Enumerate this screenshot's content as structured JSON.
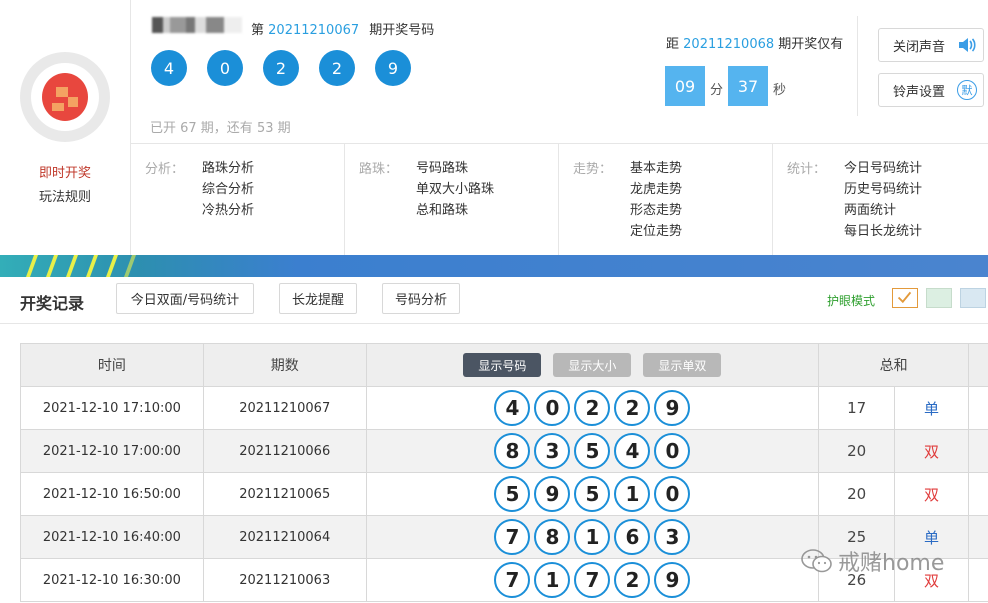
{
  "left": {
    "active_link": "即时开奖",
    "rules_link": "玩法规则"
  },
  "header": {
    "issue_prefix": "第",
    "issue": "20211210067",
    "issue_suffix": "期开奖号码",
    "balls": [
      "4",
      "0",
      "2",
      "2",
      "9"
    ],
    "opened_text": "已开 67 期，还有 53 期"
  },
  "countdown": {
    "prefix": "距",
    "next_issue": "20211210068",
    "suffix": "期开奖仅有",
    "minutes": "09",
    "minutes_unit": "分",
    "seconds": "37",
    "seconds_unit": "秒"
  },
  "side_buttons": {
    "mute": "关闭声音",
    "ringtone": "铃声设置",
    "ringtone_badge": "默"
  },
  "analysis": [
    {
      "title": "分析：",
      "items": [
        "路珠分析",
        "综合分析",
        "冷热分析"
      ]
    },
    {
      "title": "路珠：",
      "items": [
        "号码路珠",
        "单双大小路珠",
        "总和路珠"
      ]
    },
    {
      "title": "走势：",
      "items": [
        "基本走势",
        "龙虎走势",
        "形态走势",
        "定位走势"
      ]
    },
    {
      "title": "统计：",
      "items": [
        "今日号码统计",
        "历史号码统计",
        "两面统计",
        "每日长龙统计"
      ]
    }
  ],
  "toolbar": {
    "title": "开奖记录",
    "btn_today": "今日双面/号码统计",
    "btn_dragon": "长龙提醒",
    "btn_analysis": "号码分析",
    "eye_mode": "护眼模式"
  },
  "table": {
    "headers": {
      "time": "时间",
      "issue": "期数",
      "sum": "总和"
    },
    "toggles": [
      "显示号码",
      "显示大小",
      "显示单双"
    ],
    "rows": [
      {
        "time": "2021-12-10 17:10:00",
        "issue": "20211210067",
        "nums": [
          "4",
          "0",
          "2",
          "2",
          "9"
        ],
        "sum": "17",
        "oe": "单",
        "oe_type": "odd"
      },
      {
        "time": "2021-12-10 17:00:00",
        "issue": "20211210066",
        "nums": [
          "8",
          "3",
          "5",
          "4",
          "0"
        ],
        "sum": "20",
        "oe": "双",
        "oe_type": "even"
      },
      {
        "time": "2021-12-10 16:50:00",
        "issue": "20211210065",
        "nums": [
          "5",
          "9",
          "5",
          "1",
          "0"
        ],
        "sum": "20",
        "oe": "双",
        "oe_type": "even"
      },
      {
        "time": "2021-12-10 16:40:00",
        "issue": "20211210064",
        "nums": [
          "7",
          "8",
          "1",
          "6",
          "3"
        ],
        "sum": "25",
        "oe": "单",
        "oe_type": "odd"
      },
      {
        "time": "2021-12-10 16:30:00",
        "issue": "20211210063",
        "nums": [
          "7",
          "1",
          "7",
          "2",
          "9"
        ],
        "sum": "26",
        "oe": "双",
        "oe_type": "even"
      }
    ]
  },
  "watermark": "戒赌home",
  "colors": {
    "accent_blue": "#1b8fd8",
    "odd": "#2a6bc4",
    "even": "#e03a3a",
    "eye_green": "#2e9f2e"
  }
}
